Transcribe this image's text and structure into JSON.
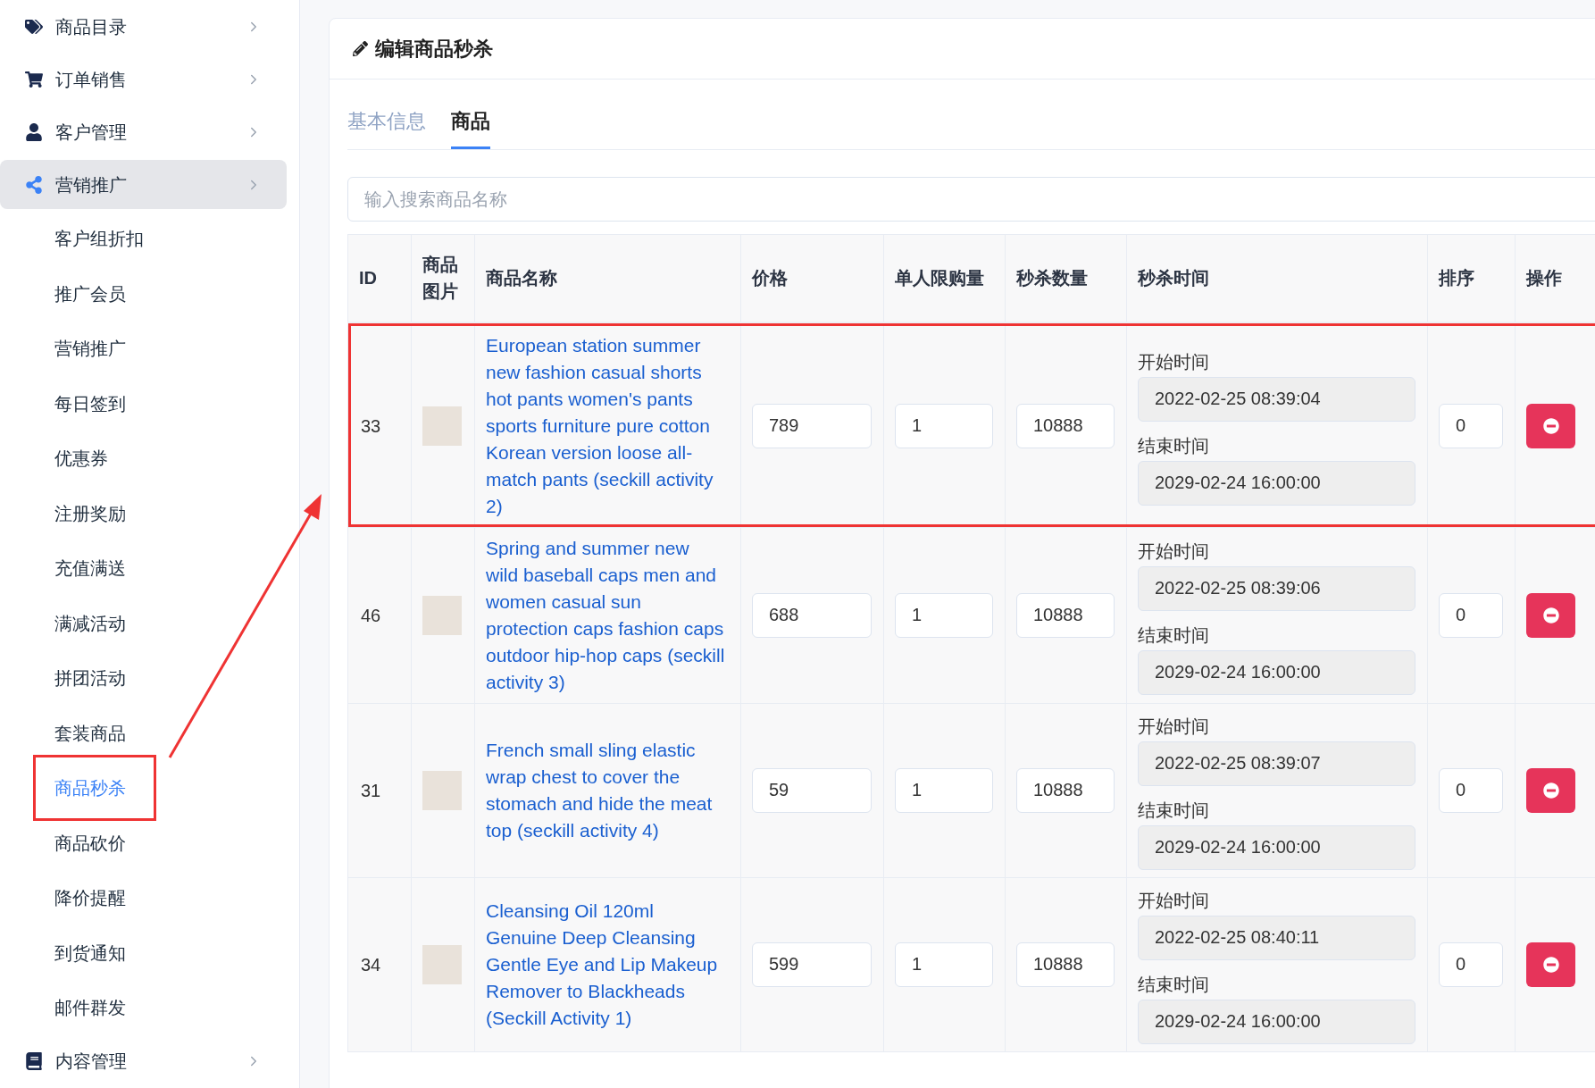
{
  "sidebar": {
    "items": [
      {
        "label": "商品目录",
        "expanded": false
      },
      {
        "label": "订单销售",
        "expanded": false
      },
      {
        "label": "客户管理",
        "expanded": false
      },
      {
        "label": "营销推广",
        "expanded": true,
        "children": [
          {
            "label": "客户组折扣",
            "selected": false,
            "highlighted": false
          },
          {
            "label": "推广会员",
            "selected": false,
            "highlighted": false
          },
          {
            "label": "营销推广",
            "selected": false,
            "highlighted": false
          },
          {
            "label": "每日签到",
            "selected": false,
            "highlighted": false
          },
          {
            "label": "优惠券",
            "selected": false,
            "highlighted": false
          },
          {
            "label": "注册奖励",
            "selected": false,
            "highlighted": false
          },
          {
            "label": "充值满送",
            "selected": false,
            "highlighted": false
          },
          {
            "label": "满减活动",
            "selected": false,
            "highlighted": false
          },
          {
            "label": "拼团活动",
            "selected": false,
            "highlighted": false
          },
          {
            "label": "套装商品",
            "selected": false,
            "highlighted": false
          },
          {
            "label": "商品秒杀",
            "selected": true,
            "highlighted": true
          },
          {
            "label": "商品砍价",
            "selected": false,
            "highlighted": false
          },
          {
            "label": "降价提醒",
            "selected": false,
            "highlighted": false
          },
          {
            "label": "到货通知",
            "selected": false,
            "highlighted": false
          },
          {
            "label": "邮件群发",
            "selected": false,
            "highlighted": false
          }
        ]
      },
      {
        "label": "内容管理",
        "expanded": false
      }
    ]
  },
  "card": {
    "title": "编辑商品秒杀",
    "tabs": [
      {
        "label": "基本信息",
        "selected": false
      },
      {
        "label": "商品",
        "selected": true
      }
    ],
    "search": {
      "placeholder": "输入搜索商品名称"
    },
    "table": {
      "columns": [
        "ID",
        "商品图片",
        "商品名称",
        "价格",
        "单人限购量",
        "秒杀数量",
        "秒杀时间",
        "排序",
        "操作"
      ],
      "rows": [
        {
          "id": "33",
          "name": "European station summer new fashion casual shorts hot pants women's pants sports furniture pure cotton Korean version loose all-match pants (seckill activity 2)",
          "price": "789",
          "limit": "1",
          "quantity": "10888",
          "start_label": "开始时间",
          "start": "2022-02-25 08:39:04",
          "end_label": "结束时间",
          "end": "2029-02-24 16:00:00",
          "sort": "0",
          "highlighted": true
        },
        {
          "id": "46",
          "name": "Spring and summer new wild baseball caps men and women casual sun protection caps fashion caps outdoor hip-hop caps (seckill activity 3)",
          "price": "688",
          "limit": "1",
          "quantity": "10888",
          "start_label": "开始时间",
          "start": "2022-02-25 08:39:06",
          "end_label": "结束时间",
          "end": "2029-02-24 16:00:00",
          "sort": "0",
          "highlighted": false
        },
        {
          "id": "31",
          "name": "French small sling elastic wrap chest to cover the stomach and hide the meat top (seckill activity 4)",
          "price": "59",
          "limit": "1",
          "quantity": "10888",
          "start_label": "开始时间",
          "start": "2022-02-25 08:39:07",
          "end_label": "结束时间",
          "end": "2029-02-24 16:00:00",
          "sort": "0",
          "highlighted": false
        },
        {
          "id": "34",
          "name": "Cleansing Oil 120ml Genuine Deep Cleansing Gentle Eye and Lip Makeup Remover to Blackheads (Seckill Activity 1)",
          "price": "599",
          "limit": "1",
          "quantity": "10888",
          "start_label": "开始时间",
          "start": "2022-02-25 08:40:11",
          "end_label": "结束时间",
          "end": "2029-02-24 16:00:00",
          "sort": "0",
          "highlighted": false
        }
      ]
    }
  }
}
